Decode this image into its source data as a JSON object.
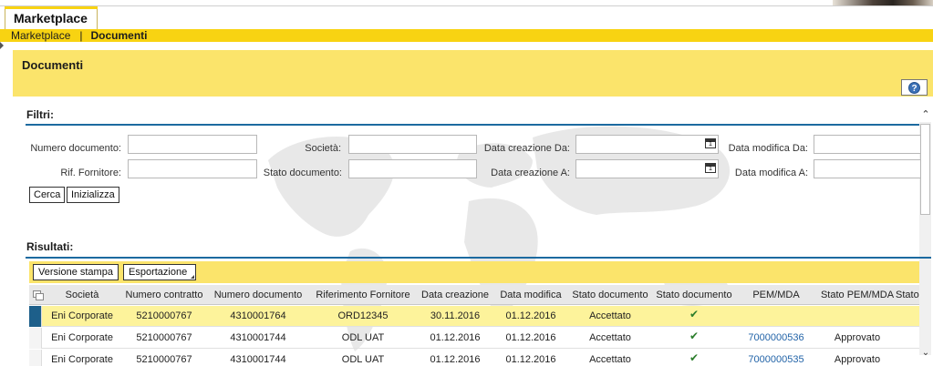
{
  "tabs": {
    "active_tab": "Marketplace"
  },
  "breadcrumb": {
    "parent": "Marketplace",
    "separator": "|",
    "current": "Documenti"
  },
  "page": {
    "title": "Documenti",
    "help_symbol": "?"
  },
  "filters": {
    "section_title": "Filtri:",
    "numero_documento_label": "Numero documento:",
    "societa_label": "Società:",
    "data_creazione_da_label": "Data creazione Da:",
    "data_modifica_da_label": "Data modifica Da:",
    "rif_fornitore_label": "Rif. Fornitore:",
    "stato_documento_label": "Stato documento:",
    "data_creazione_a_label": "Data creazione A:",
    "data_modifica_a_label": "Data modifica A:",
    "numero_documento_value": "",
    "societa_value": "",
    "data_creazione_da_value": "",
    "data_modifica_da_value": "",
    "rif_fornitore_value": "",
    "stato_documento_value": "",
    "data_creazione_a_value": "",
    "data_modifica_a_value": "",
    "search_button": "Cerca",
    "reset_button": "Inizializza"
  },
  "results": {
    "section_title": "Risultati:",
    "print_button": "Versione stampa",
    "export_button": "Esportazione",
    "columns": [
      "Società",
      "Numero contratto",
      "Numero documento",
      "Riferimento Fornitore",
      "Data creazione",
      "Data modifica",
      "Stato documento",
      "Stato documento",
      "PEM/MDA",
      "Stato PEM/MDA",
      "Stato"
    ],
    "rows": [
      {
        "societa": "Eni Corporate",
        "contratto": "5210000767",
        "documento": "4310001764",
        "riferimento": "ORD12345",
        "creazione": "30.11.2016",
        "modifica": "01.12.2016",
        "stato": "Accettato",
        "stato_icon": "✔",
        "pem": "",
        "stato_pem": ""
      },
      {
        "societa": "Eni Corporate",
        "contratto": "5210000767",
        "documento": "4310001744",
        "riferimento": "ODL UAT",
        "creazione": "01.12.2016",
        "modifica": "01.12.2016",
        "stato": "Accettato",
        "stato_icon": "✔",
        "pem": "7000000536",
        "stato_pem": "Approvato"
      },
      {
        "societa": "Eni Corporate",
        "contratto": "5210000767",
        "documento": "4310001744",
        "riferimento": "ODL UAT",
        "creazione": "01.12.2016",
        "modifica": "01.12.2016",
        "stato": "Accettato",
        "stato_icon": "✔",
        "pem": "7000000535",
        "stato_pem": "Approvato"
      }
    ]
  },
  "colors": {
    "accent_yellow": "#f8d312",
    "header_yellow": "#fbe46b",
    "selected_row": "#fdf39b",
    "rule_blue": "#1c6aa0",
    "link_blue": "#2364a8"
  }
}
